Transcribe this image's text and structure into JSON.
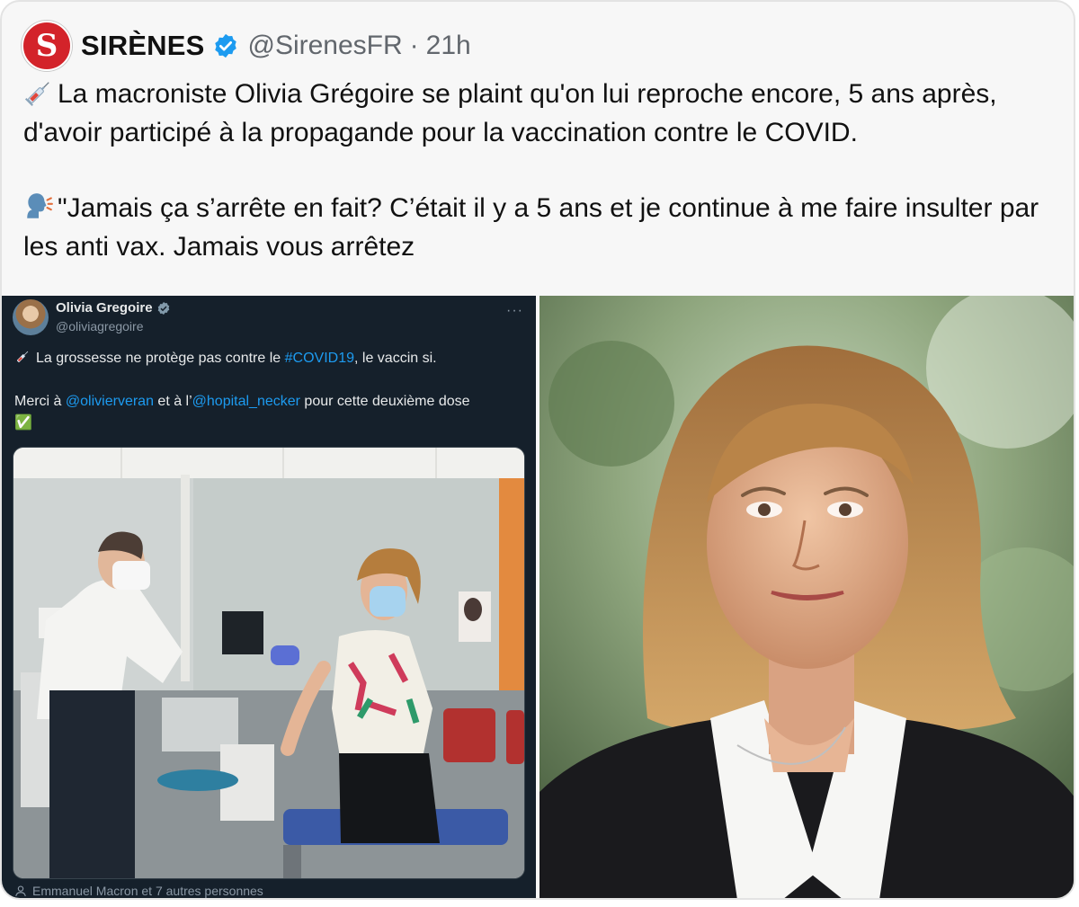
{
  "tweet": {
    "account_name": "SIRÈNES",
    "avatar_letter": "S",
    "handle": "@SirenesFR",
    "separator": "·",
    "time": "21h",
    "line1": "La macroniste Olivia Grégoire se plaint qu'on lui reproche encore, 5 ans après, d'avoir participé à la propagande pour la vaccination contre le COVID.",
    "line2": "\"Jamais ça s’arrête en fait?  C’était il y a 5 ans et je continue à me faire insulter par les anti vax.  Jamais vous arrêtez",
    "line1_icon": "syringe-icon",
    "line2_icon": "speaking-head-icon",
    "accent_color": "#d3232a",
    "verified_color": "#1d9bf0"
  },
  "embedded_tweet": {
    "name": "Olivia Gregoire",
    "handle": "@oliviagregoire",
    "more": "···",
    "text_before": "La grossesse ne protège pas contre le ",
    "hashtag": "#COVID19",
    "text_after": ", le vaccin si.",
    "thanks_before": "Merci à ",
    "mention1": "@olivierveran",
    "thanks_middle": " et à l’",
    "mention2": "@hopital_necker",
    "thanks_after": " pour cette deuxième dose",
    "check": "✅",
    "likes_line": "Emmanuel Macron et 7 autres personnes",
    "background_color": "#15202b",
    "link_color": "#1d9bf0"
  }
}
